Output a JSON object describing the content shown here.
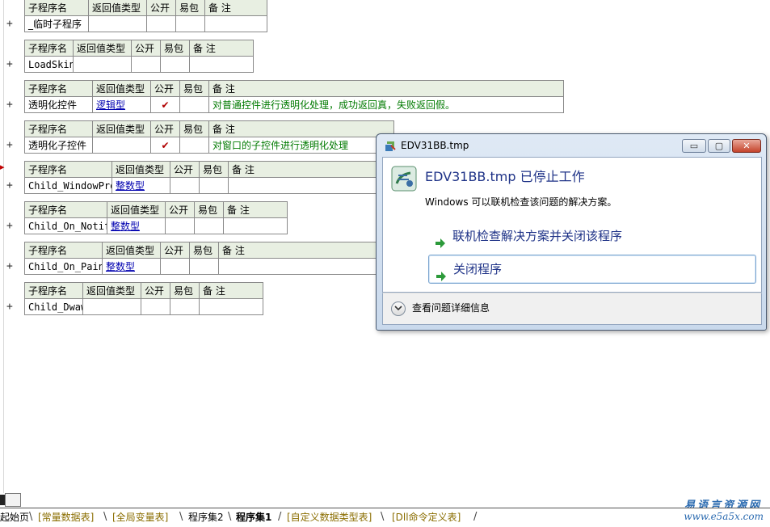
{
  "columns": {
    "name": "子程序名",
    "return_type": "返回值类型",
    "public": "公开",
    "easy_pack": "易包",
    "remark": "备 注"
  },
  "expand_symbol": "+",
  "subroutines": [
    {
      "name": "_临时子程序",
      "return_type": "",
      "public": "",
      "easy_pack": "",
      "remark": ""
    },
    {
      "name": "LoadSkin",
      "return_type": "",
      "public": "",
      "easy_pack": "",
      "remark": ""
    },
    {
      "name": "透明化控件",
      "return_type": "逻辑型",
      "public": "✔",
      "easy_pack": "",
      "remark": "对普通控件进行透明化处理，成功返回真，失败返回假。"
    },
    {
      "name": "透明化子控件",
      "return_type": "",
      "public": "✔",
      "easy_pack": "",
      "remark": "对窗口的子控件进行透明化处理"
    },
    {
      "name": "Child_WindowProc",
      "return_type": "整数型",
      "public": "",
      "easy_pack": "",
      "remark": ""
    },
    {
      "name": "Child_On_Notify",
      "return_type": "整数型",
      "public": "",
      "easy_pack": "",
      "remark": ""
    },
    {
      "name": "Child_On_Paint",
      "return_type": "整数型",
      "public": "",
      "easy_pack": "",
      "remark": ""
    },
    {
      "name": "Child_Dwaw",
      "return_type": "",
      "public": "",
      "easy_pack": "",
      "remark": ""
    }
  ],
  "dialog": {
    "title": "EDV31BB.tmp",
    "min_glyph": "▭",
    "max_glyph": "▢",
    "close_glyph": "✕",
    "headline": "EDV31BB.tmp 已停止工作",
    "subline": "Windows 可以联机检查该问题的解决方案。",
    "option_online": "联机检查解决方案并关闭该程序",
    "option_close": "关闭程序",
    "details": "查看问题详细信息",
    "title_icon": "app-icon",
    "big_icon": "program-icon",
    "arrow_icon": "green-arrow-icon"
  },
  "tabs": [
    {
      "label": "起始页",
      "style": "plain"
    },
    {
      "label": "[常量数据表]",
      "style": "inactive"
    },
    {
      "label": "[全局变量表]",
      "style": "inactive"
    },
    {
      "label": "程序集2",
      "style": "plain"
    },
    {
      "label": "程序集1",
      "style": "active"
    },
    {
      "label": "[自定义数据类型表]",
      "style": "inactive"
    },
    {
      "label": "[Dll命令定义表]",
      "style": "inactive"
    }
  ],
  "watermark": {
    "line1": "易语言资源网",
    "line2": "www.e5a5x.com"
  }
}
